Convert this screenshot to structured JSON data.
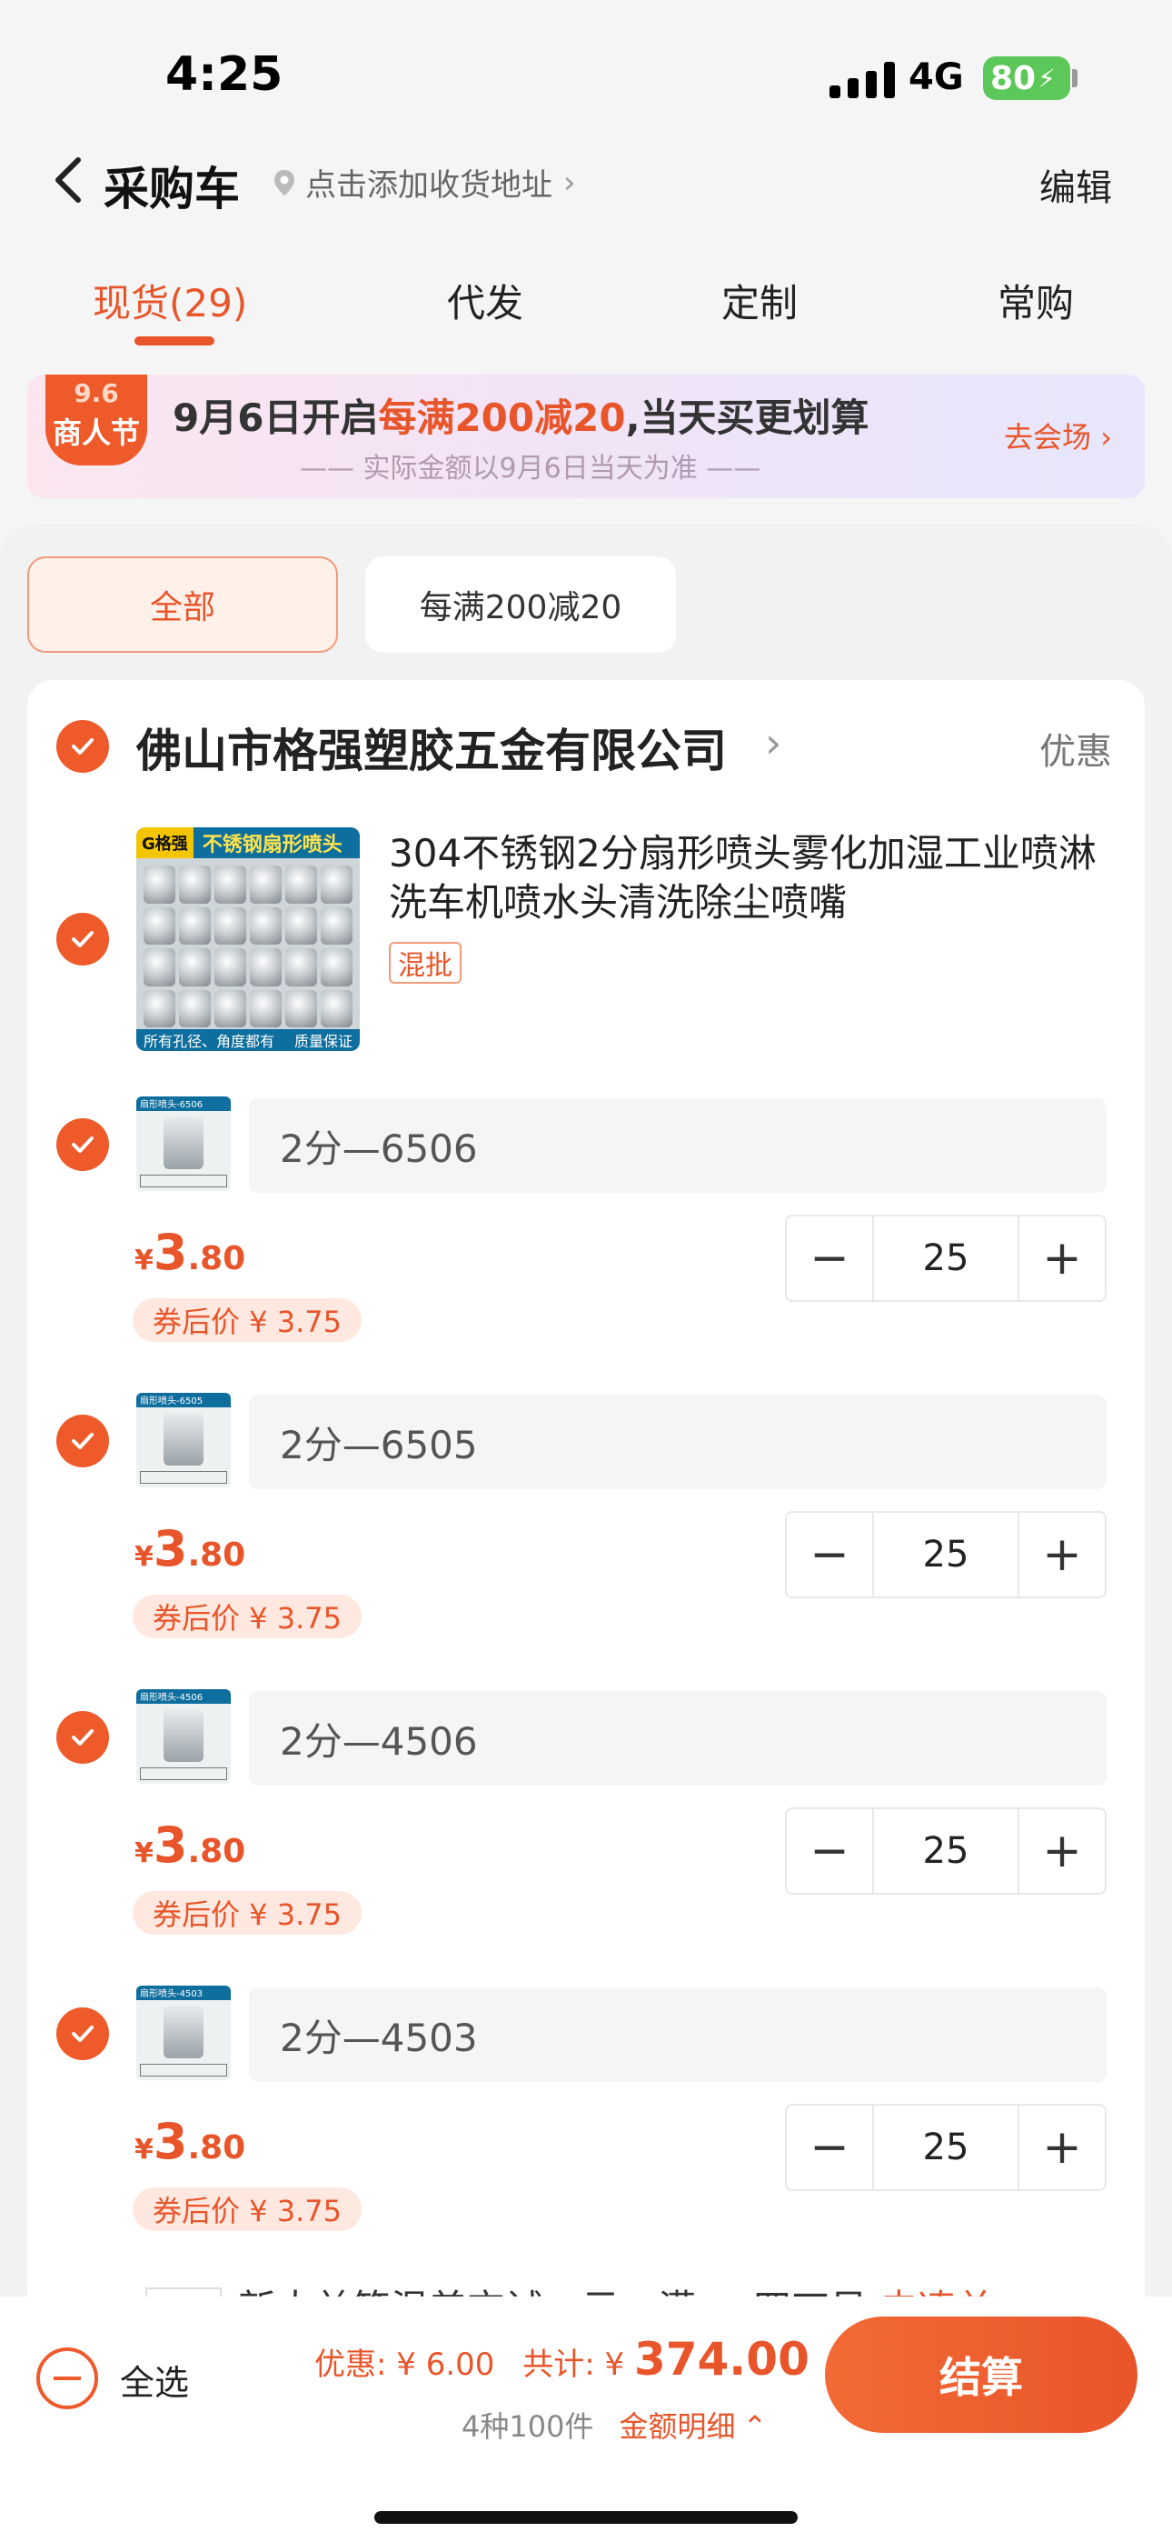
{
  "status_bar": {
    "time": "4:25",
    "network": "4G",
    "battery": "80"
  },
  "nav": {
    "title": "采购车",
    "address_hint": "点击添加收货地址",
    "edit_label": "编辑"
  },
  "tabs": [
    {
      "label": "现货(29)",
      "active": true
    },
    {
      "label": "代发",
      "active": false
    },
    {
      "label": "定制",
      "active": false
    },
    {
      "label": "常购",
      "active": false
    }
  ],
  "banner": {
    "badge_top": "9.6",
    "badge_bottom": "商人节",
    "text_prefix": "9月6日开启",
    "text_highlight": "每满200减20",
    "text_suffix": ",当天买更划算",
    "subtext": "—— 实际金额以9月6日当天为准 ——",
    "cta": "去会场 ›"
  },
  "filters": [
    {
      "label": "全部",
      "active": true
    },
    {
      "label": "每满200减20",
      "active": false
    }
  ],
  "shop": {
    "name": "佛山市格强塑胶五金有限公司",
    "promo_label": "优惠"
  },
  "product": {
    "title": "304不锈钢2分扇形喷头雾化加湿工业喷淋洗车机喷水头清洗除尘喷嘴",
    "tag": "混批",
    "image_header": "不锈钢扇形喷头",
    "image_logo": "G格强",
    "image_footer_left": "所有孔径、角度都有",
    "image_footer_right": "质量保证"
  },
  "skus": [
    {
      "option": "2分—6506",
      "thumb_label": "扇形喷头-6506",
      "price_currency": "¥",
      "price_int": "3",
      "price_dec": ".80",
      "coupon_price": "券后价 ¥ 3.75",
      "qty": "25"
    },
    {
      "option": "2分—6505",
      "thumb_label": "扇形喷头-6505",
      "price_currency": "¥",
      "price_int": "3",
      "price_dec": ".80",
      "coupon_price": "券后价 ¥ 3.75",
      "qty": "25"
    },
    {
      "option": "2分—4506",
      "thumb_label": "扇形喷头-4506",
      "price_currency": "¥",
      "price_int": "3",
      "price_dec": ".80",
      "coupon_price": "券后价 ¥ 3.75",
      "qty": "25"
    },
    {
      "option": "2分—4503",
      "thumb_label": "扇形喷头-4503",
      "price_currency": "¥",
      "price_int": "3",
      "price_dec": ".80",
      "coupon_price": "券后价 ¥ 3.75",
      "qty": "25"
    }
  ],
  "next_item_peek": {
    "text": "新大益笆温差交试，示，满。。四兀贝",
    "link": "去凑单"
  },
  "bottom": {
    "select_all": "全选",
    "discount_label": "优惠: ¥ 6.00",
    "total_label": "共计: ¥",
    "total_value": "374.00",
    "count_summary": "4种100件",
    "detail_label": "金额明细",
    "checkout": "结算"
  },
  "colors": {
    "accent": "#e8552a",
    "check": "#ee5a2a",
    "battery": "#5cc85a"
  }
}
